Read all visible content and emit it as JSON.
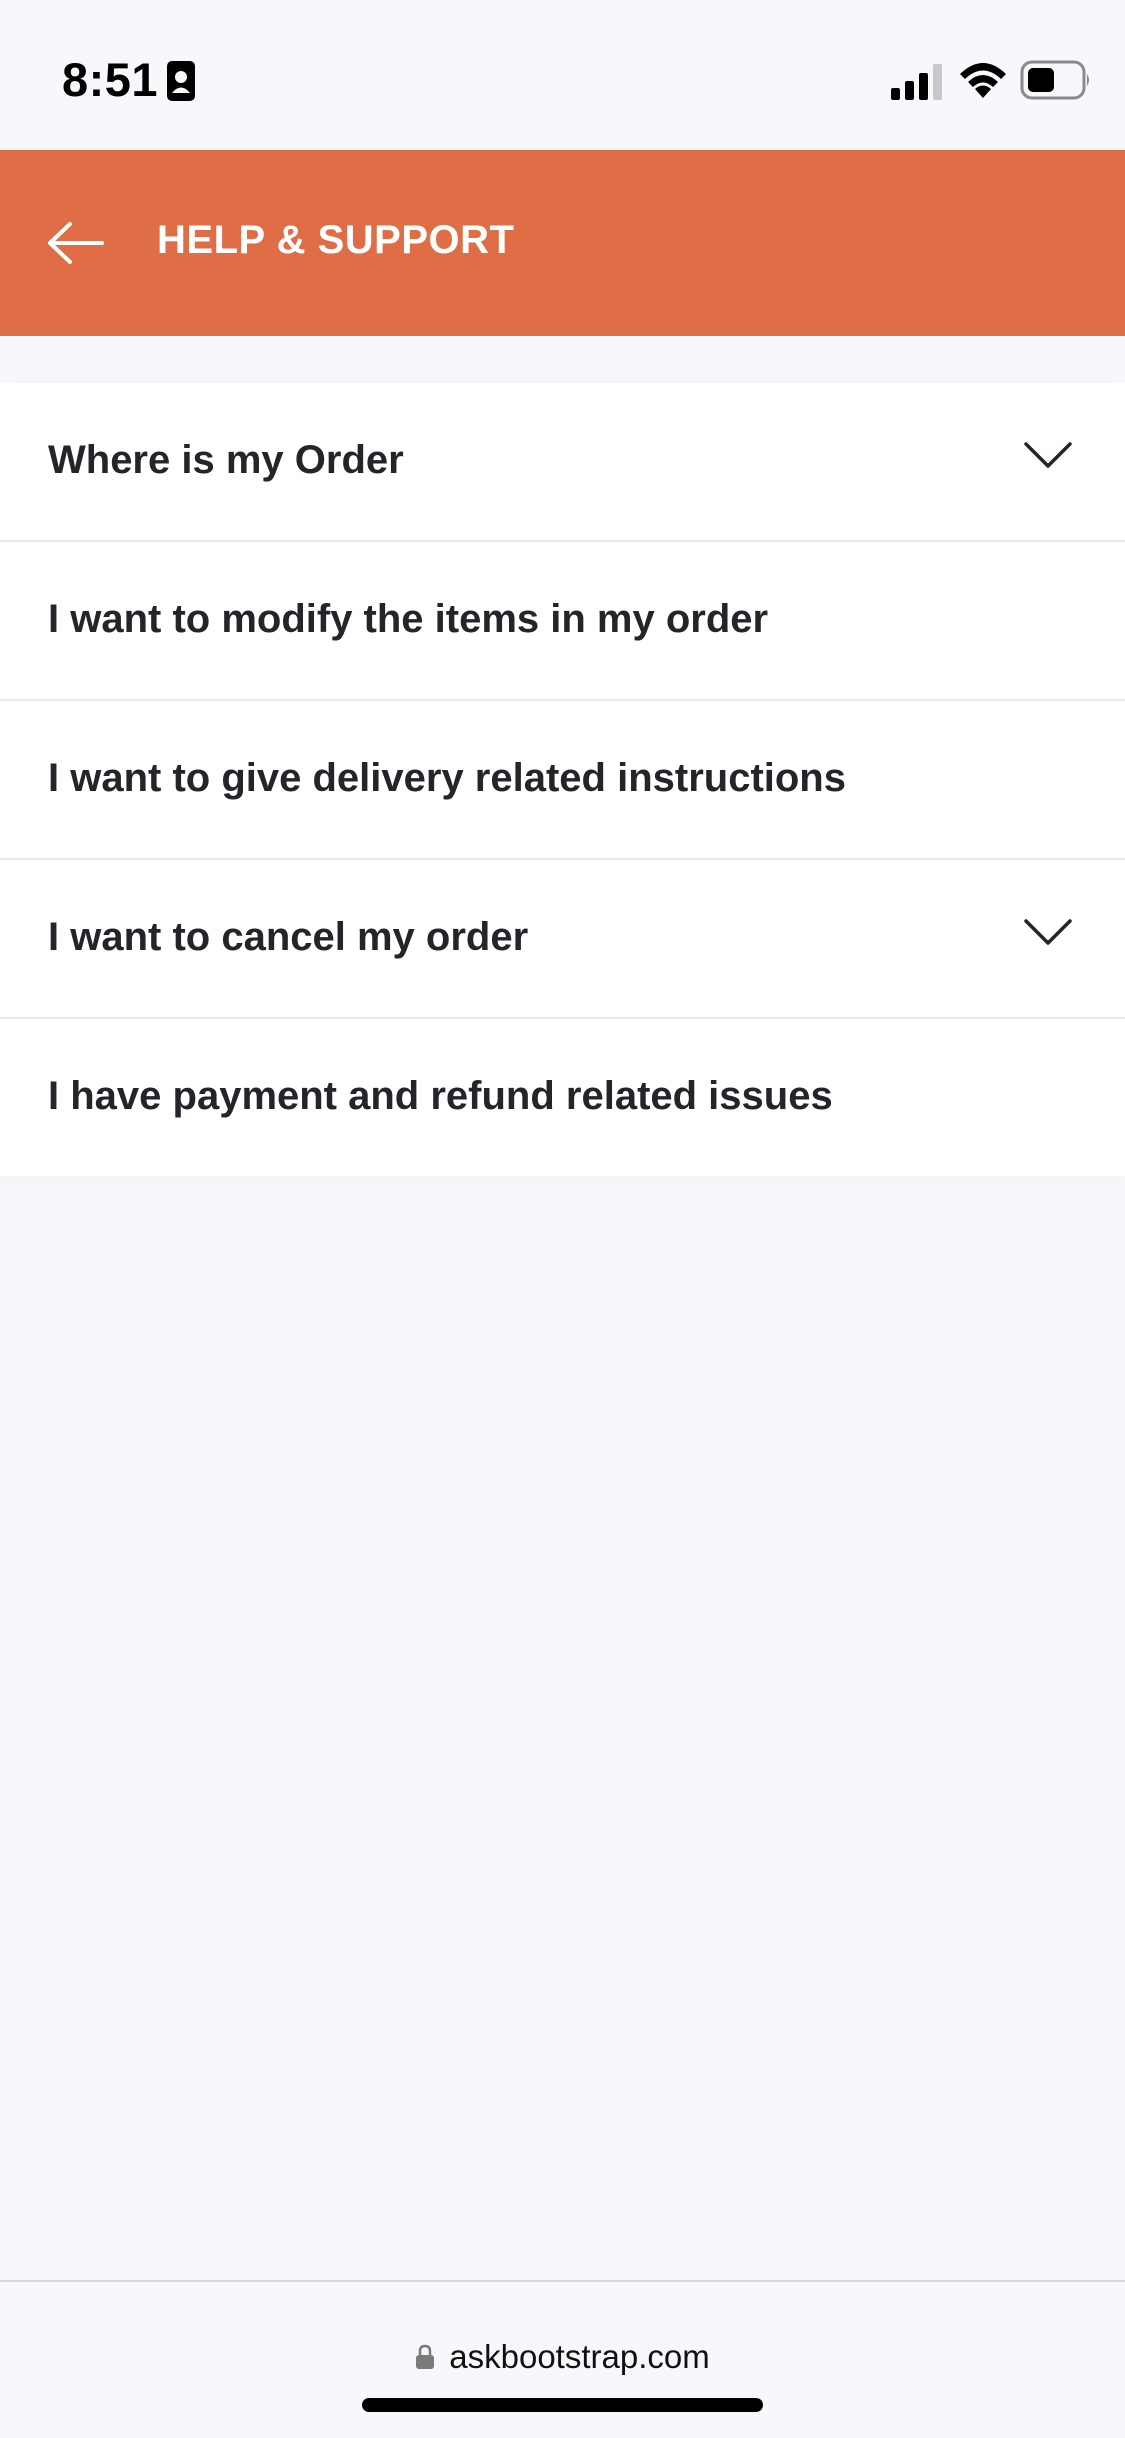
{
  "status_bar": {
    "time": "8:51",
    "icons": [
      "contact-card-icon",
      "cellular-signal-icon",
      "wifi-icon",
      "battery-icon"
    ]
  },
  "header": {
    "title": "HELP & SUPPORT",
    "back_icon": "arrow-left-icon",
    "background_color": "#df6d45"
  },
  "faq": {
    "items": [
      {
        "label": "Where is my Order",
        "expandable": true
      },
      {
        "label": "I want to modify the items in my order",
        "expandable": false
      },
      {
        "label": "I want to give delivery related instructions",
        "expandable": false
      },
      {
        "label": "I want to cancel my order",
        "expandable": true
      },
      {
        "label": "I have payment and refund related issues",
        "expandable": false
      }
    ]
  },
  "browser": {
    "url": "askbootstrap.com",
    "lock_icon": "lock-icon"
  }
}
